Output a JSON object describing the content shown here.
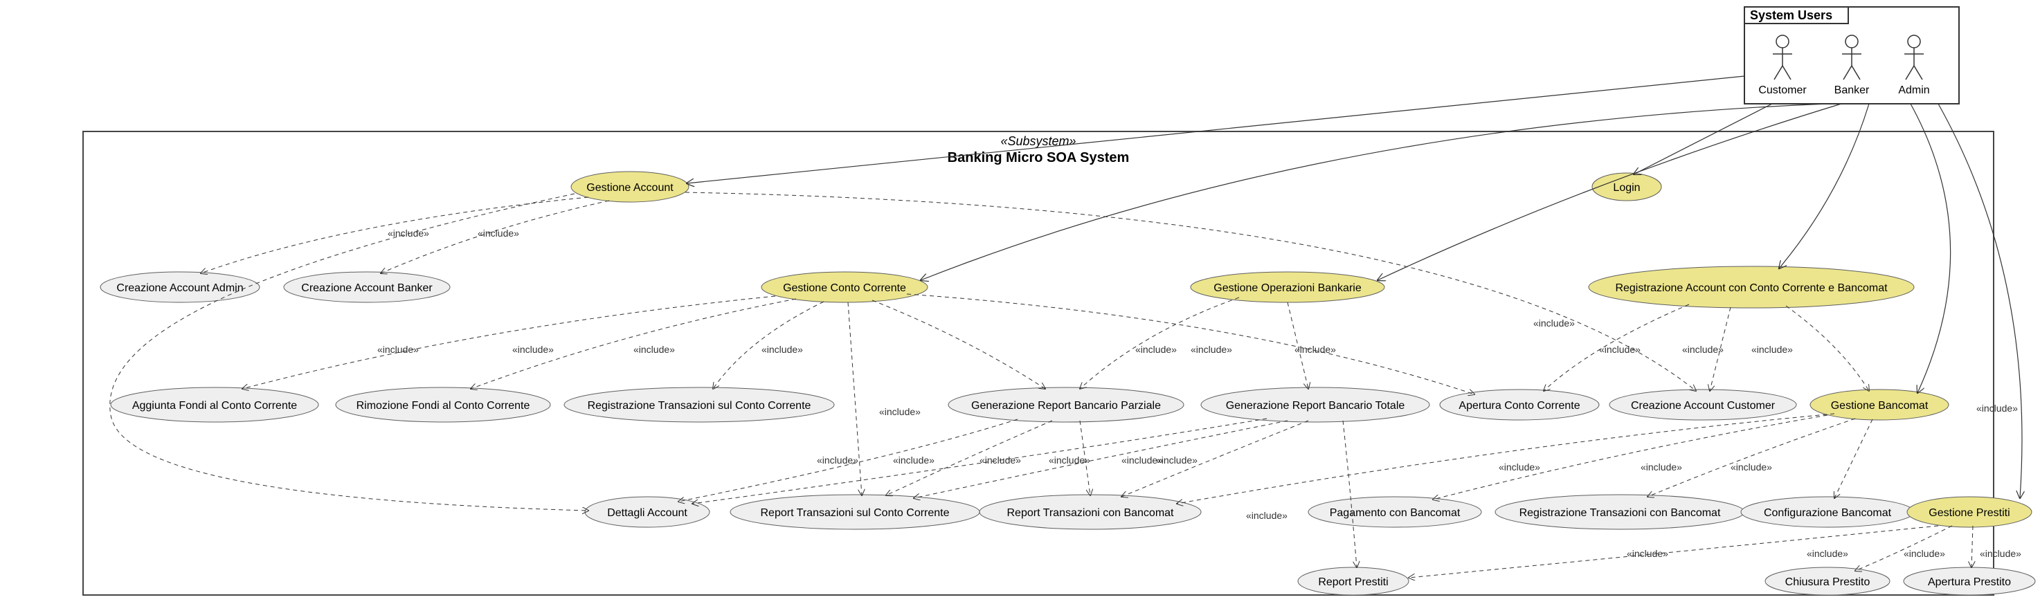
{
  "system_users_box": {
    "title": "System Users",
    "actors": [
      "Customer",
      "Banker",
      "Admin"
    ]
  },
  "subsystem": {
    "stereotype": "«Subsystem»",
    "title": "Banking Micro SOA System"
  },
  "usecases": {
    "gestione_account": "Gestione Account",
    "login": "Login",
    "creazione_account_admin": "Creazione Account Admin",
    "creazione_account_banker": "Creazione Account Banker",
    "gestione_conto_corrente": "Gestione Conto Corrente",
    "gestione_operazioni_bankarie": "Gestione Operazioni Bankarie",
    "registrazione_account_full": "Registrazione Account con Conto Corrente e Bancomat",
    "aggiunta_fondi": "Aggiunta Fondi al Conto Corrente",
    "rimozione_fondi": "Rimozione Fondi al Conto Corrente",
    "registrazione_transazioni_conto": "Registrazione Transazioni sul Conto Corrente",
    "gen_report_parziale": "Generazione Report Bancario Parziale",
    "gen_report_totale": "Generazione Report Bancario Totale",
    "apertura_conto": "Apertura Conto Corrente",
    "creazione_account_customer": "Creazione Account Customer",
    "gestione_bancomat": "Gestione Bancomat",
    "dettagli_account": "Dettagli Account",
    "report_transazioni_conto": "Report Transazioni sul Conto Corrente",
    "report_transazioni_bancomat": "Report Transazioni con Bancomat",
    "pagamento_bancomat": "Pagamento con Bancomat",
    "registrazione_transazioni_bancomat": "Registrazione Transazioni con Bancomat",
    "configurazione_bancomat": "Configurazione Bancomat",
    "gestione_prestiti": "Gestione Prestiti",
    "report_prestiti": "Report Prestiti",
    "chiusura_prestito": "Chiusura Prestito",
    "apertura_prestito": "Apertura Prestito"
  },
  "include_label": "«include»",
  "colors": {
    "highlight": "#ECE58D",
    "plain": "#EFEFEF",
    "border": "#5E5E5E"
  }
}
